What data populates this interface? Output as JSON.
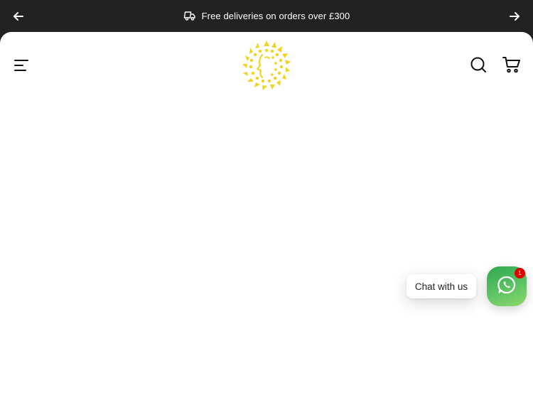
{
  "announcement": {
    "text": "Free deliveries on orders over £300",
    "icon": "delivery-truck-icon",
    "prev_icon": "arrow-left-icon",
    "next_icon": "arrow-right-icon",
    "background": "#222222",
    "text_color": "#ffffff"
  },
  "header": {
    "menu_icon": "hamburger-menu-icon",
    "logo": "sun-face-logo",
    "logo_color": "#f2d21b",
    "search_icon": "search-icon",
    "cart_icon": "cart-icon"
  },
  "chat_widget": {
    "label": "Chat with us",
    "icon": "whatsapp-icon",
    "badge_count": "1",
    "accent": "#4bb85a",
    "badge_color": "#e00000"
  }
}
